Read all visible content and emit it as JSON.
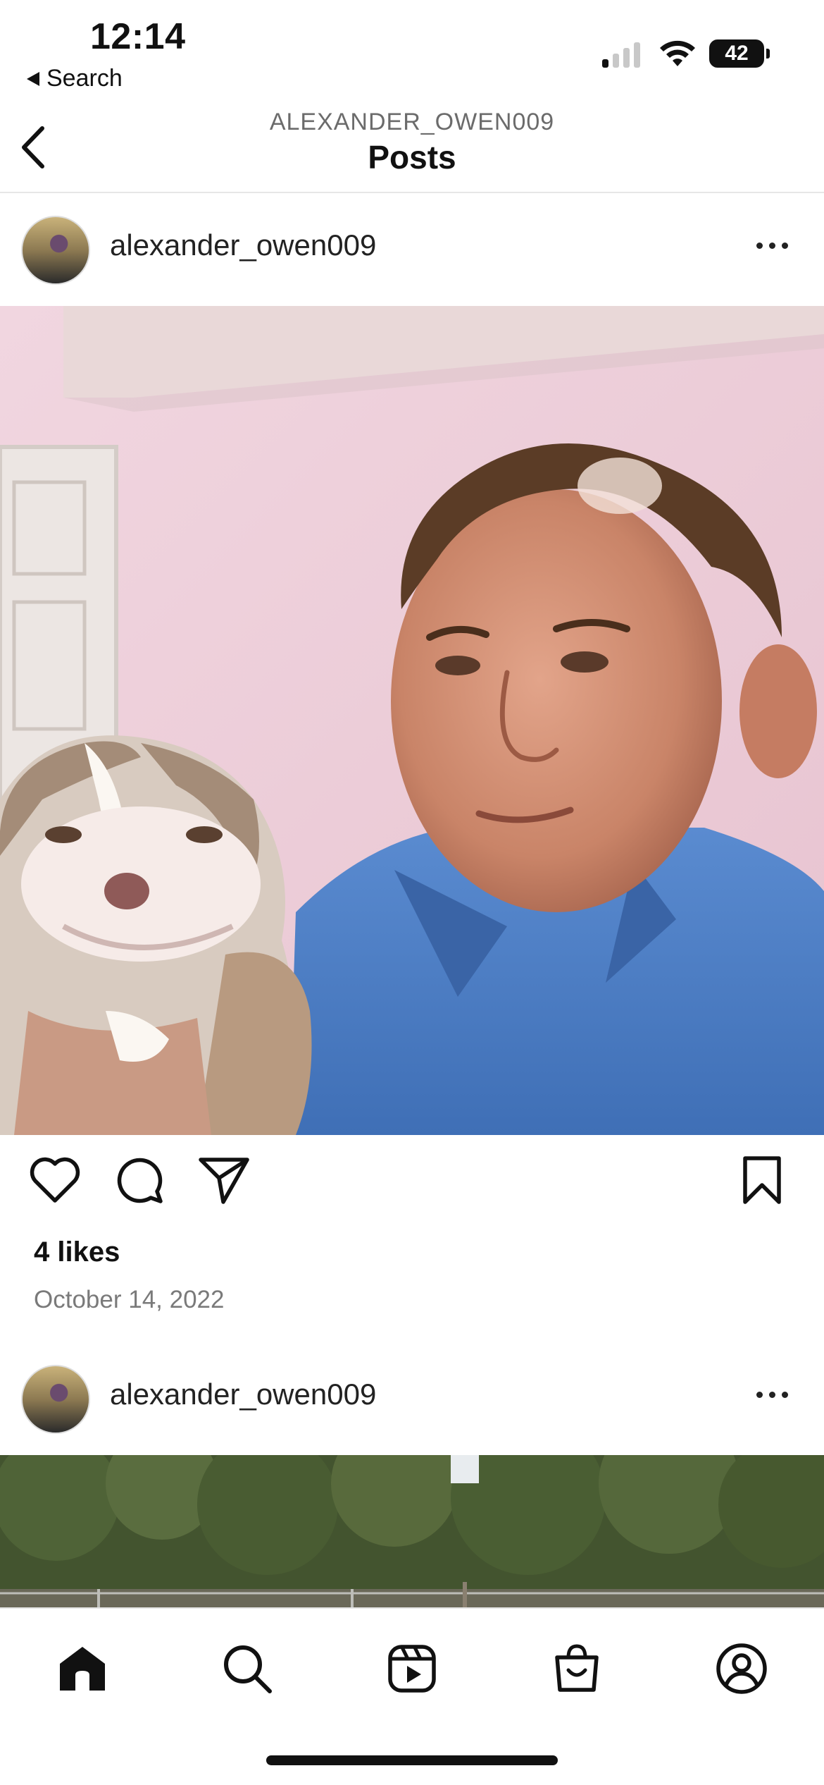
{
  "status_bar": {
    "time": "12:14",
    "back_app_label": "Search",
    "battery_level": "42",
    "signal_bars_active": 1,
    "signal_bars_total": 4
  },
  "header": {
    "subtitle": "ALEXANDER_OWEN009",
    "title": "Posts"
  },
  "posts": [
    {
      "username": "alexander_owen009",
      "likes": "4 likes",
      "date": "October 14, 2022"
    },
    {
      "username": "alexander_owen009"
    }
  ],
  "actions": {
    "icons": [
      "heart-icon",
      "comment-icon",
      "share-icon",
      "bookmark-icon"
    ]
  },
  "tab_bar": {
    "tabs": [
      "home-icon",
      "search-icon",
      "reels-icon",
      "shop-icon",
      "profile-icon"
    ],
    "active": "home-icon"
  },
  "colors": {
    "text": "#111111",
    "secondary_text": "#6b6b6b",
    "divider": "#e7e7e7"
  }
}
